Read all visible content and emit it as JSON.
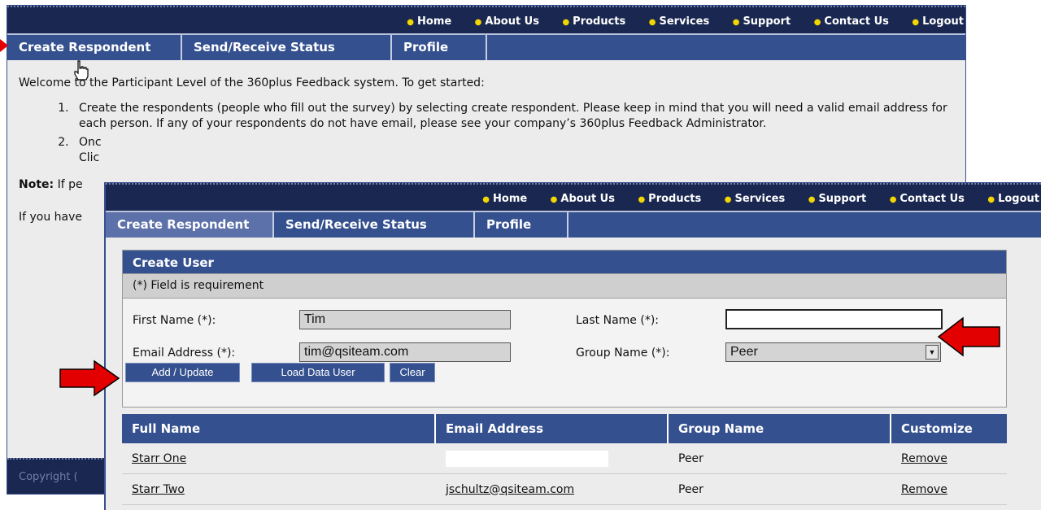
{
  "top_nav": [
    "Home",
    "About Us",
    "Products",
    "Services",
    "Support",
    "Contact Us",
    "Logout"
  ],
  "tabs": [
    "Create Respondent",
    "Send/Receive Status",
    "Profile"
  ],
  "intro": {
    "welcome": "Welcome to the Participant Level of the 360plus Feedback system. To get started:",
    "step1": "Create the respondents (people who fill out the survey) by selecting create respondent. Please keep in mind that you will need a valid email address for each person. If any of your respondents do not have email, please see your company’s 360plus Feedback Administrator.",
    "step2_a": "Onc",
    "step2_b": "Clic",
    "note_label": "Note:",
    "note_text": "If pe",
    "if_text": "If you have",
    "copyright": "Copyright ("
  },
  "form": {
    "title": "Create User",
    "required_note": "(*) Field is requirement",
    "first_name_label": "First Name (*):",
    "first_name_value": "Tim",
    "last_name_label": "Last Name (*):",
    "last_name_value": "",
    "email_label": "Email Address (*):",
    "email_value": "tim@qsiteam.com",
    "group_label": "Group Name (*):",
    "group_value": "Peer",
    "buttons": {
      "add": "Add / Update",
      "load": "Load Data User",
      "clear": "Clear"
    }
  },
  "table": {
    "headers": [
      "Full Name",
      "Email Address",
      "Group Name",
      "Customize"
    ],
    "rows": [
      {
        "name": "Starr One",
        "email": "",
        "group": "Peer",
        "action": "Remove"
      },
      {
        "name": "Starr Two",
        "email": "jschultz@qsiteam.com",
        "group": "Peer",
        "action": "Remove"
      }
    ]
  },
  "colors": {
    "nav_dark": "#1a2750",
    "tab_blue": "#34508f",
    "accent_dot": "#f2d600",
    "arrow_red": "#e30000"
  }
}
